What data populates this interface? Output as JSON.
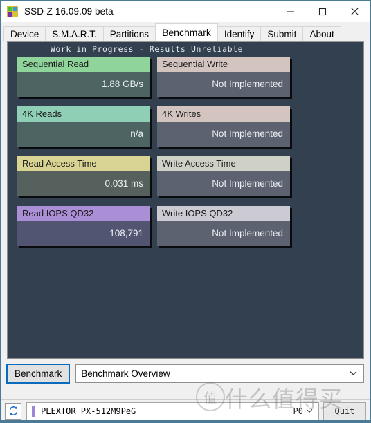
{
  "window": {
    "title": "SSD-Z 16.09.09 beta",
    "icon": "ssdz-logo-icon",
    "controls": {
      "minimize": "minimize-icon",
      "maximize": "maximize-icon",
      "close": "close-icon"
    }
  },
  "tabs": [
    {
      "label": "Device",
      "active": false
    },
    {
      "label": "S.M.A.R.T.",
      "active": false
    },
    {
      "label": "Partitions",
      "active": false
    },
    {
      "label": "Benchmark",
      "active": true
    },
    {
      "label": "Identify",
      "active": false
    },
    {
      "label": "Submit",
      "active": false
    },
    {
      "label": "About",
      "active": false
    }
  ],
  "benchmark": {
    "banner": "Work in Progress - Results Unreliable",
    "panel_bg": "#334050",
    "rows": [
      {
        "left": {
          "title": "Sequential Read",
          "value": "1.88 GB/s",
          "header_color": "#8FD49B",
          "body_color": "#4E6463"
        },
        "right": {
          "title": "Sequential Write",
          "value": "Not Implemented",
          "header_color": "#D3C4C0",
          "body_color": "#5C6270"
        }
      },
      {
        "left": {
          "title": "4K Reads",
          "value": "n/a",
          "header_color": "#8ECFB6",
          "body_color": "#4E6463"
        },
        "right": {
          "title": "4K Writes",
          "value": "Not Implemented",
          "header_color": "#D3C4C0",
          "body_color": "#5C6270"
        }
      },
      {
        "left": {
          "title": "Read Access Time",
          "value": "0.031 ms",
          "header_color": "#D9D493",
          "body_color": "#56605C"
        },
        "right": {
          "title": "Write Access Time",
          "value": "Not Implemented",
          "header_color": "#CFD0C6",
          "body_color": "#5C6270"
        }
      },
      {
        "left": {
          "title": "Read IOPS QD32",
          "value": "108,791",
          "header_color": "#AB8FD6",
          "body_color": "#525571"
        },
        "right": {
          "title": "Write IOPS QD32",
          "value": "Not Implemented",
          "header_color": "#CCCAD2",
          "body_color": "#5C6270"
        }
      }
    ]
  },
  "controls": {
    "run_button": "Benchmark",
    "overview_select": {
      "value": "Benchmark Overview",
      "arrow": "chevron-down-icon"
    }
  },
  "statusbar": {
    "refresh_icon": "refresh-icon",
    "drive": "PLEXTOR PX-512M9PeG",
    "drive_swatch_color": "#9E86D6",
    "port_select": {
      "value": "P0",
      "arrow": "chevron-down-icon"
    },
    "quit_button": "Quit"
  },
  "watermark": {
    "badge": "值",
    "text": "什么值得买"
  }
}
